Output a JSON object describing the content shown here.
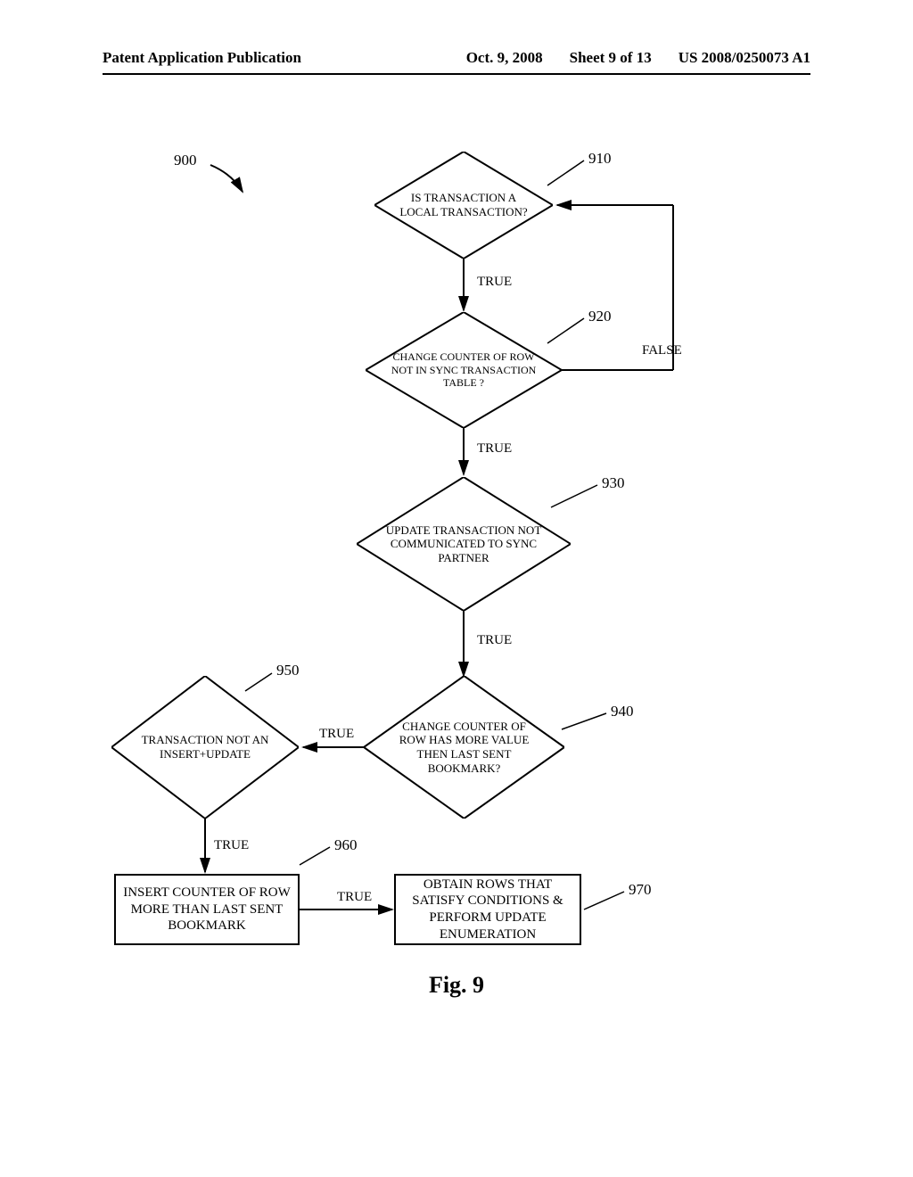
{
  "header": {
    "left": "Patent Application Publication",
    "date": "Oct. 9, 2008",
    "sheet": "Sheet 9 of 13",
    "pubnum": "US 2008/0250073 A1"
  },
  "refs": {
    "r900": "900",
    "r910": "910",
    "r920": "920",
    "r930": "930",
    "r940": "940",
    "r950": "950",
    "r960": "960",
    "r970": "970"
  },
  "nodes": {
    "n910": "IS TRANSACTION A LOCAL TRANSACTION?",
    "n920": "CHANGE COUNTER OF ROW NOT IN SYNC TRANSACTION TABLE ?",
    "n930": "UPDATE TRANSACTION NOT COMMUNICATED TO SYNC PARTNER",
    "n940": "CHANGE COUNTER OF ROW HAS MORE VALUE THEN LAST SENT BOOKMARK?",
    "n950": "TRANSACTION NOT AN INSERT+UPDATE",
    "n960": "INSERT COUNTER OF ROW MORE THAN LAST SENT BOOKMARK",
    "n970": "OBTAIN ROWS THAT SATISFY CONDITIONS & PERFORM UPDATE ENUMERATION"
  },
  "edges": {
    "true": "TRUE",
    "false": "FALSE"
  },
  "caption": "Fig. 9"
}
